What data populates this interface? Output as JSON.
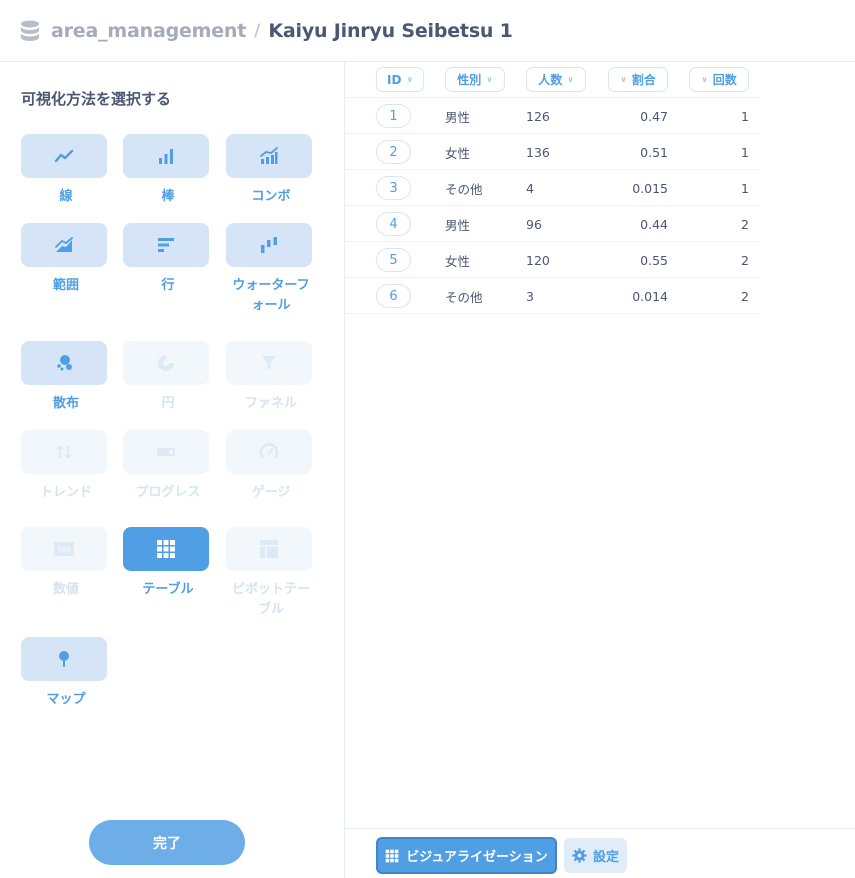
{
  "header": {
    "database": "area_management",
    "separator": "/",
    "title": "Kaiyu Jinryu Seibetsu 1"
  },
  "sidebar": {
    "title": "可視化方法を選択する",
    "items": [
      {
        "label": "線",
        "icon": "line-chart-icon",
        "state": "enabled"
      },
      {
        "label": "棒",
        "icon": "bar-chart-icon",
        "state": "enabled"
      },
      {
        "label": "コンボ",
        "icon": "combo-chart-icon",
        "state": "enabled"
      },
      {
        "label": "範囲",
        "icon": "area-chart-icon",
        "state": "enabled"
      },
      {
        "label": "行",
        "icon": "row-chart-icon",
        "state": "enabled"
      },
      {
        "label": "ウォーターフォール",
        "icon": "waterfall-chart-icon",
        "state": "enabled"
      },
      {
        "label": "散布",
        "icon": "scatter-chart-icon",
        "state": "enabled"
      },
      {
        "label": "円",
        "icon": "pie-chart-icon",
        "state": "disabled"
      },
      {
        "label": "ファネル",
        "icon": "funnel-icon",
        "state": "disabled"
      },
      {
        "label": "トレンド",
        "icon": "trend-icon",
        "state": "disabled"
      },
      {
        "label": "プログレス",
        "icon": "progress-icon",
        "state": "disabled"
      },
      {
        "label": "ゲージ",
        "icon": "gauge-icon",
        "state": "disabled"
      },
      {
        "label": "数値",
        "icon": "number-icon",
        "state": "disabled"
      },
      {
        "label": "テーブル",
        "icon": "table-icon",
        "state": "selected"
      },
      {
        "label": "ピボットテーブル",
        "icon": "pivot-table-icon",
        "state": "disabled"
      },
      {
        "label": "マップ",
        "icon": "map-pin-icon",
        "state": "enabled"
      }
    ],
    "number_icon_text": "100",
    "done_label": "完了"
  },
  "table": {
    "columns": [
      "ID",
      "性別",
      "人数",
      "割合",
      "回数"
    ],
    "rows": [
      [
        "1",
        "男性",
        "126",
        "0.47",
        "1"
      ],
      [
        "2",
        "女性",
        "136",
        "0.51",
        "1"
      ],
      [
        "3",
        "その他",
        "4",
        "0.015",
        "1"
      ],
      [
        "4",
        "男性",
        "96",
        "0.44",
        "2"
      ],
      [
        "5",
        "女性",
        "120",
        "0.55",
        "2"
      ],
      [
        "6",
        "その他",
        "3",
        "0.014",
        "2"
      ]
    ]
  },
  "footer": {
    "visualization_label": "ビジュアライゼーション",
    "settings_label": "設定"
  },
  "colors": {
    "brand": "#509ee3",
    "tile": "#d5e5f7",
    "tile_disabled": "#f2f7fc"
  }
}
